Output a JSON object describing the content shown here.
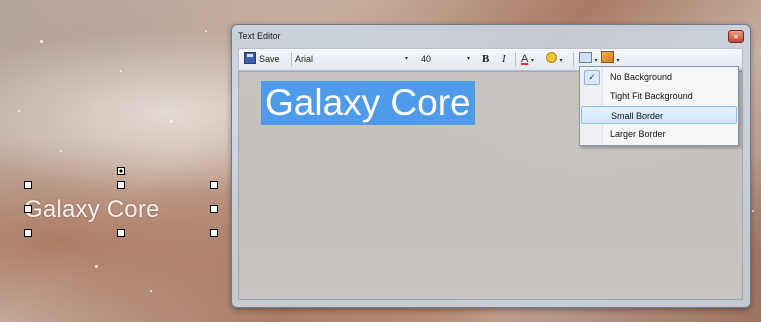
{
  "canvas": {
    "text": "Galaxy Core"
  },
  "window": {
    "title": "Text Editor",
    "close_symbol": "×"
  },
  "toolbar": {
    "save_label": "Save",
    "font_family": "Arial",
    "font_size": "40",
    "bold_label": "B",
    "italic_label": "I",
    "font_color_label": "A",
    "dropdown_arrow": "▾"
  },
  "editor": {
    "text": "Galaxy Core"
  },
  "background_menu": {
    "items": [
      {
        "label": "No Background",
        "checked": true
      },
      {
        "label": "Tight Fit Background",
        "checked": false
      },
      {
        "label": "Small Border",
        "checked": false,
        "hovered": true
      },
      {
        "label": "Larger Border",
        "checked": false
      }
    ],
    "check_symbol": "✓"
  },
  "colors": {
    "selection": "#4f9bea",
    "menu_hover": "#cfe5fb",
    "close_button": "#c14a33"
  }
}
